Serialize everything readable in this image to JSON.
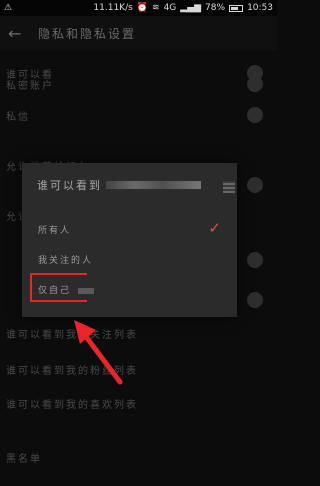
{
  "status_bar": {
    "speed": "11.11K/s",
    "signal": "4G",
    "battery": "78%",
    "time": "10:53"
  },
  "app_bar": {
    "title": "隐私和隐私设置"
  },
  "background_rows": [
    {
      "label": "谁可以看",
      "toggle": true
    },
    {
      "label": "私密账户",
      "toggle": true
    },
    {
      "label": "私信",
      "toggle": true
    },
    {
      "label": "",
      "toggle": false
    },
    {
      "label": "允许推荐给好友",
      "toggle": true
    },
    {
      "label": "",
      "toggle": true
    },
    {
      "label": "允许",
      "toggle": false
    },
    {
      "label": "",
      "toggle": true
    },
    {
      "label": "",
      "toggle": true
    },
    {
      "label": "谁可以看到我的关注列表",
      "toggle": false
    },
    {
      "label": "谁可以看到我的粉丝列表",
      "toggle": false
    },
    {
      "label": "谁可以看到我的喜欢列表",
      "toggle": false
    },
    {
      "label": "",
      "toggle": false
    },
    {
      "label": "黑名单",
      "toggle": false
    }
  ],
  "dialog": {
    "title": "谁可以看到",
    "options": [
      {
        "label": "所有人",
        "selected": true
      },
      {
        "label": "我关注的人",
        "selected": false
      },
      {
        "label": "仅自己",
        "selected": false
      }
    ]
  },
  "colors": {
    "highlight": "#e8262a",
    "check": "#e0533b"
  }
}
